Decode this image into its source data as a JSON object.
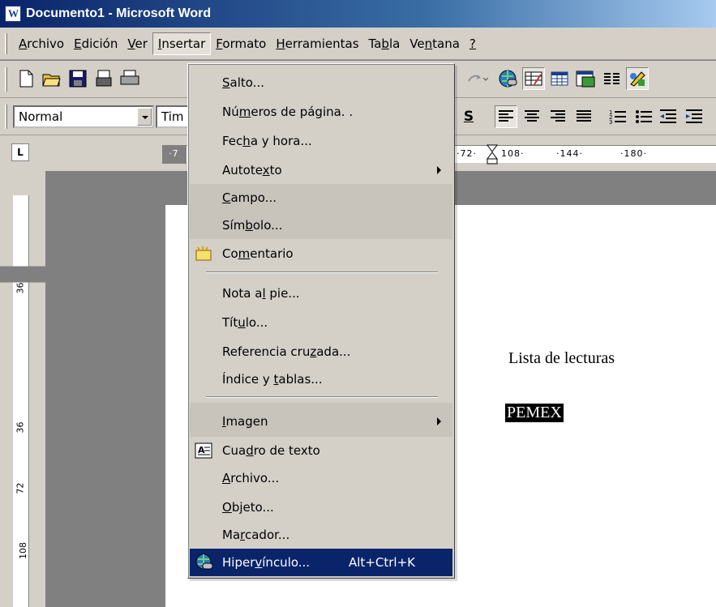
{
  "window": {
    "title": "Documento1 - Microsoft Word",
    "app_icon": "word-icon"
  },
  "menubar": {
    "items": [
      {
        "label": "Archivo"
      },
      {
        "label": "Edición"
      },
      {
        "label": "Ver"
      },
      {
        "label": "Insertar",
        "active": true
      },
      {
        "label": "Formato"
      },
      {
        "label": "Herramientas"
      },
      {
        "label": "Tabla"
      },
      {
        "label": "Ventana"
      },
      {
        "label": "?"
      }
    ]
  },
  "toolbar": {
    "style_combo": "Normal",
    "font_combo": "Tim",
    "icons": [
      "new-document-icon",
      "open-icon",
      "save-icon",
      "permission-icon",
      "print-icon",
      "redo-icon",
      "hyperlink-icon",
      "tables-borders-icon",
      "insert-table-icon",
      "insert-excel-icon",
      "columns-icon",
      "drawing-icon"
    ],
    "shadow_label": "S"
  },
  "ruler": {
    "horizontal_labels": [
      "·7",
      "·72·",
      "108·",
      "·144·",
      "·180·"
    ],
    "vertical_labels": [
      "36",
      "36",
      "72",
      "108"
    ]
  },
  "insert_menu": {
    "items": [
      {
        "label": "Salto...",
        "underline": "S"
      },
      {
        "label": "Números de página. .",
        "underline": "m"
      },
      {
        "label": "Fecha y hora...",
        "underline": "h"
      },
      {
        "label": "Autotexto",
        "underline": "x",
        "submenu": true
      },
      {
        "label": "Campo...",
        "underline": "C"
      },
      {
        "label": "Símbolo...",
        "underline": "b"
      },
      {
        "label": "Comentario",
        "underline": "e",
        "icon": "comment-icon"
      },
      {
        "label": "Nota al pie...",
        "underline": "l"
      },
      {
        "label": "Título...",
        "underline": "u"
      },
      {
        "label": "Referencia cruzada...",
        "underline": "z"
      },
      {
        "label": "Índice y tablas...",
        "underline": "t"
      },
      {
        "label": "Imagen",
        "underline": "I",
        "submenu": true
      },
      {
        "label": "Cuadro de texto",
        "underline": "d",
        "icon": "textbox-icon"
      },
      {
        "label": "Archivo...",
        "underline": "A"
      },
      {
        "label": "Objeto...",
        "underline": "O"
      },
      {
        "label": "Marcador...",
        "underline": "r"
      },
      {
        "label": "Hipervínculo...",
        "underline": "v",
        "icon": "hyperlink-icon",
        "shortcut": "Alt+Ctrl+K",
        "selected": true
      }
    ]
  },
  "document": {
    "lines": [
      "Lista de lecturas",
      "PEMEX"
    ]
  },
  "colors": {
    "selection": "#0a246a",
    "face": "#d4d0c8",
    "workspace": "#808080"
  }
}
